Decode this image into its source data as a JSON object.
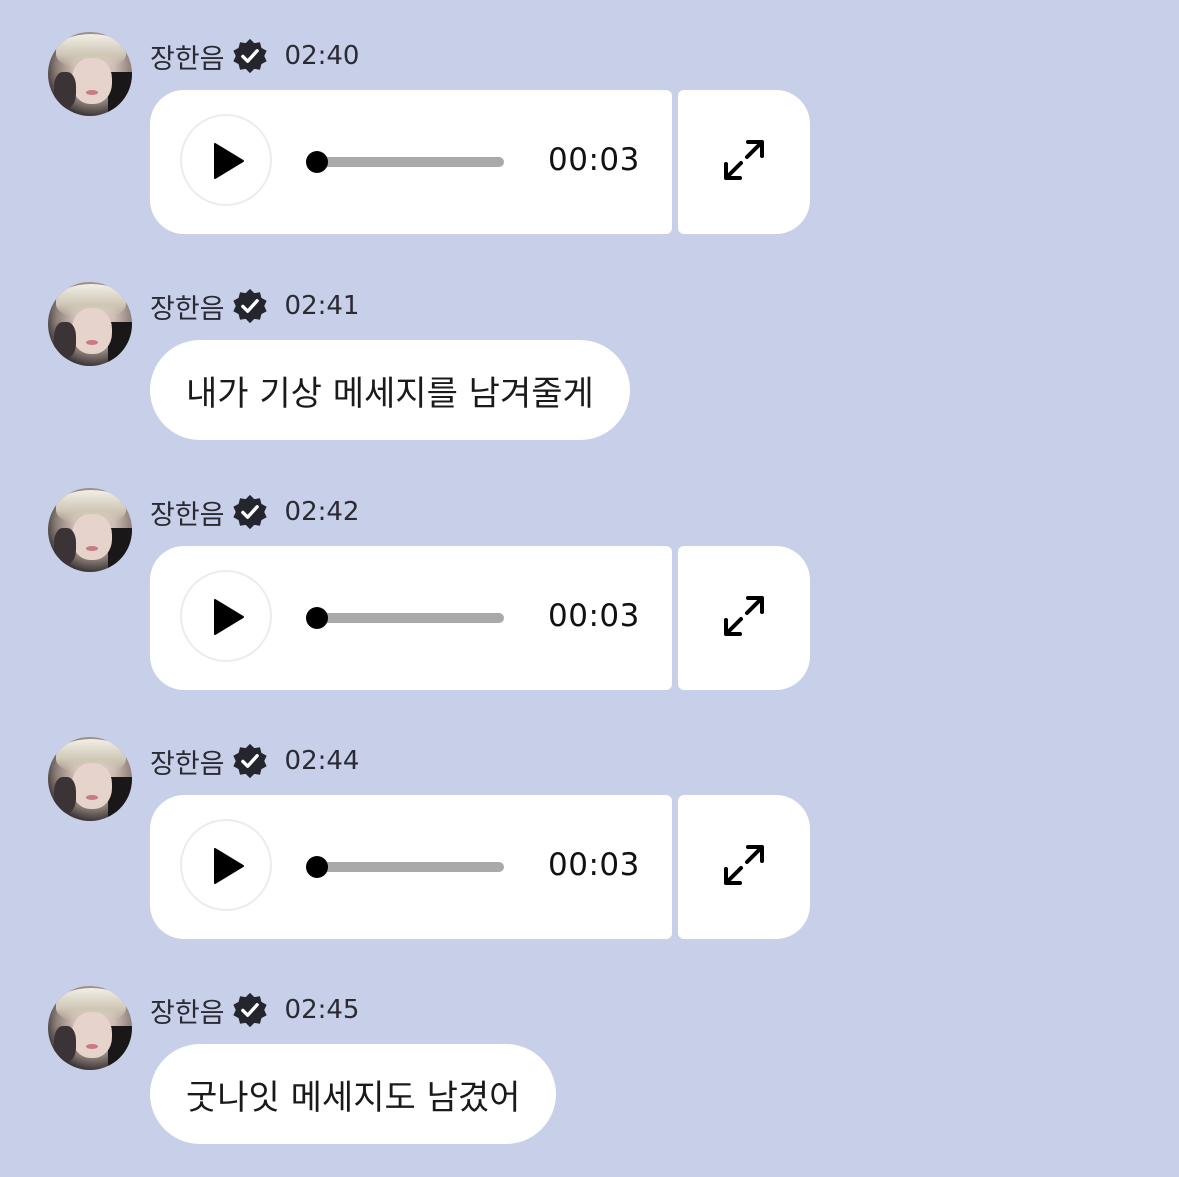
{
  "messages": [
    {
      "type": "audio",
      "sender": "장한음",
      "time": "02:40",
      "duration": "00:03",
      "progress": 0
    },
    {
      "type": "text",
      "sender": "장한음",
      "time": "02:41",
      "text": "내가 기상 메세지를 남겨줄게"
    },
    {
      "type": "audio",
      "sender": "장한음",
      "time": "02:42",
      "duration": "00:03",
      "progress": 0
    },
    {
      "type": "audio",
      "sender": "장한음",
      "time": "02:44",
      "duration": "00:03",
      "progress": 0
    },
    {
      "type": "text",
      "sender": "장한음",
      "time": "02:45",
      "text": "굿나잇 메세지도 남겼어"
    }
  ],
  "icons": {
    "verified": "verified-badge-icon",
    "play": "play-icon",
    "expand": "expand-icon"
  },
  "colors": {
    "background": "#c7cfe9",
    "bubble": "#ffffff",
    "text": "#1e1e26",
    "track": "#a9a9a9"
  }
}
